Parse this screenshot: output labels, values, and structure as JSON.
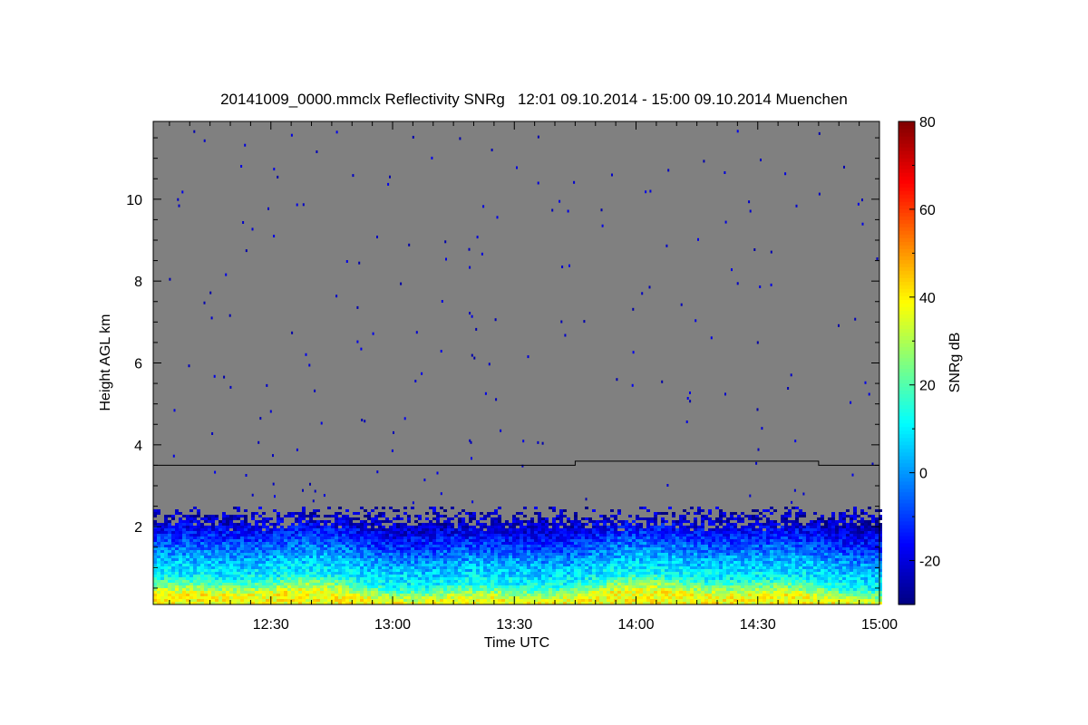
{
  "chart_data": {
    "type": "heatmap",
    "title": "20141009_0000.mmclx Reflectivity SNRg   12:01 09.10.2014 - 15:00 09.10.2014 Muenchen",
    "xlabel": "Time UTC",
    "ylabel": "Height AGL km",
    "x_range": [
      "12:01",
      "15:00"
    ],
    "x_ticks": [
      "12:30",
      "13:00",
      "13:30",
      "14:00",
      "14:30",
      "15:00"
    ],
    "ylim": [
      0.1,
      11.9
    ],
    "y_ticks": [
      2,
      4,
      6,
      8,
      10
    ],
    "background_color": "#808080",
    "colorbar": {
      "label": "SNRg dB",
      "range": [
        -30,
        80
      ],
      "ticks": [
        -20,
        0,
        20,
        40,
        60,
        80
      ],
      "colormap": "jet"
    },
    "boundary_line": {
      "color": "#000000",
      "segments": [
        {
          "from": "12:01",
          "to": "13:45",
          "height_km": 3.5
        },
        {
          "from": "13:45",
          "to": "14:45",
          "height_km": 3.6
        },
        {
          "from": "14:45",
          "to": "15:00",
          "height_km": 3.5
        }
      ]
    },
    "echo_layer": {
      "top_km": 2.5,
      "near_surface_snr_db": 40,
      "layer_top_snr_db": -25,
      "note_bands": [
        {
          "height_km": 0.3,
          "snr_db": 38
        },
        {
          "height_km": 0.7,
          "snr_db": 12
        },
        {
          "height_km": 1.2,
          "snr_db": 2
        },
        {
          "height_km": 1.7,
          "snr_db": -12
        },
        {
          "height_km": 2.2,
          "snr_db": -24
        }
      ]
    }
  }
}
